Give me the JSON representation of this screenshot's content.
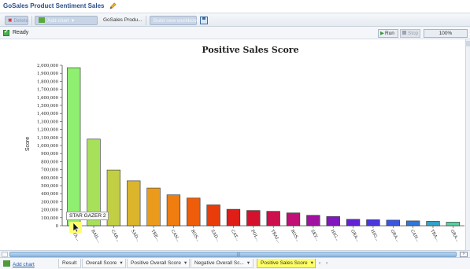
{
  "app": {
    "title": "GoSales Product Sentiment Sales"
  },
  "toolbar": {
    "delete_label": "Delete",
    "add_chart_label": "Add chart",
    "breadcrumb": "GoSales Produ...",
    "build_label": "Build new workbook"
  },
  "status": {
    "text": "Ready",
    "run_label": "Run",
    "stop_label": "Stop",
    "zoom": "100%"
  },
  "chart_data": {
    "type": "bar",
    "title": "Positive Sales Score",
    "xlabel": "",
    "ylabel": "Score",
    "ylim": [
      0,
      2000000
    ],
    "yticks": [
      "0",
      "100,000",
      "200,000",
      "300,000",
      "400,000",
      "500,000",
      "600,000",
      "700,000",
      "800,000",
      "900,000",
      "1,000,000",
      "1,100,000",
      "1,200,000",
      "1,300,000",
      "1,400,000",
      "1,500,000",
      "1,600,000",
      "1,700,000",
      "1,800,000",
      "1,900,000",
      "2,000,000"
    ],
    "categories": [
      "STA...",
      "BAIL...",
      "CAR...",
      "SAD...",
      "TRE...",
      "CAN...",
      "ROS...",
      "SAD...",
      "CAT...",
      "POL...",
      "TRAI...",
      "ROS...",
      "SKY...",
      "HIG...",
      "GRA...",
      "HIG...",
      "GRA...",
      "CAN...",
      "TRA...",
      "GRA..."
    ],
    "values": [
      1970000,
      1080000,
      695000,
      560000,
      470000,
      385000,
      345000,
      260000,
      205000,
      190000,
      180000,
      160000,
      130000,
      115000,
      80000,
      75000,
      70000,
      60000,
      55000,
      45000
    ],
    "colors": [
      "#8fef70",
      "#a7e059",
      "#c2cf45",
      "#dbb52b",
      "#eb9b1b",
      "#f07d0f",
      "#ef5d0a",
      "#e83d0a",
      "#de1e17",
      "#d4122e",
      "#cd0f4e",
      "#c00f75",
      "#a013a0",
      "#8018bd",
      "#6322d6",
      "#4a37df",
      "#3a55df",
      "#2e77db",
      "#31a3c7",
      "#58cfa0"
    ],
    "grid": false,
    "legend": "none"
  },
  "tooltip": {
    "text": "STAR GAZER 2"
  },
  "tabs": {
    "add_chart_link": "Add chart",
    "items": [
      {
        "label": "Result",
        "dropdown": false
      },
      {
        "label": "Overall Score",
        "dropdown": true
      },
      {
        "label": "Positive Overall Score",
        "dropdown": true
      },
      {
        "label": "Negative Overall Sc...",
        "dropdown": true
      },
      {
        "label": "Positive Sales Score",
        "dropdown": true,
        "active": true
      }
    ],
    "nav_prev": "‹",
    "nav_next": "›"
  }
}
